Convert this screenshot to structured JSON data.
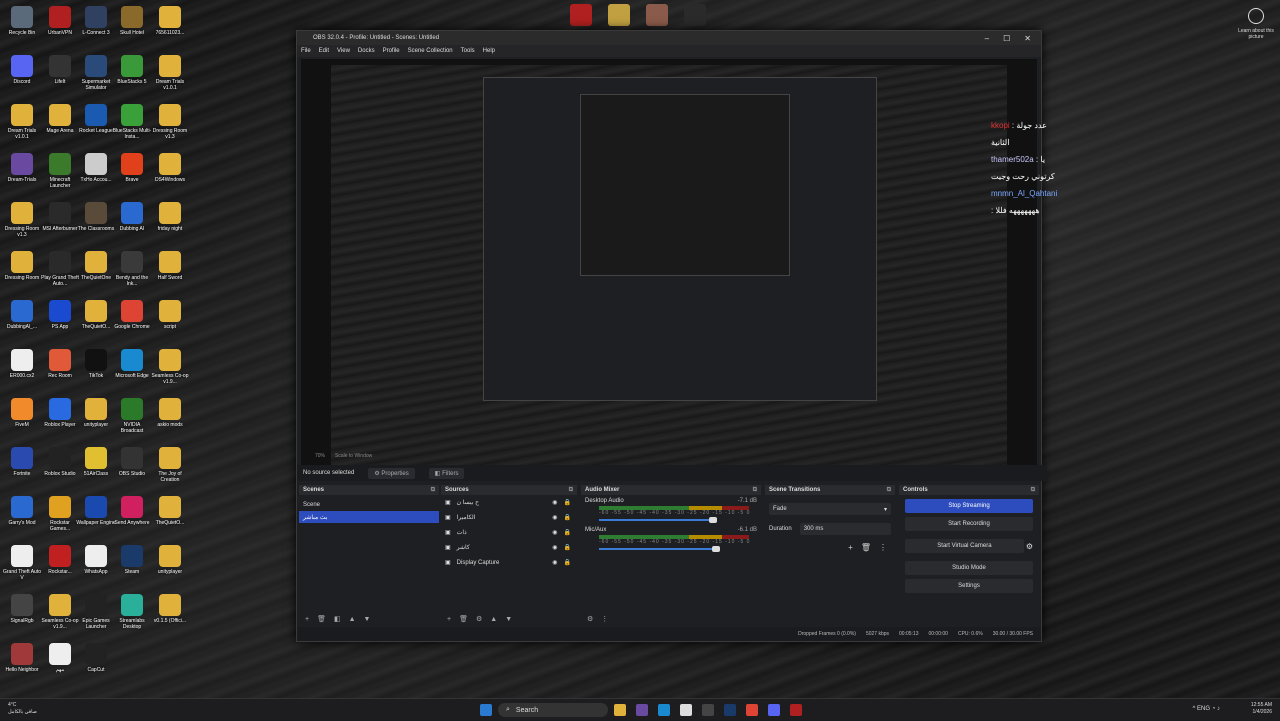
{
  "desktop": {
    "icons": [
      {
        "label": "Recycle Bin",
        "icon": "recycle-bin-icon",
        "color": "#5a6a7a"
      },
      {
        "label": "UrbanVPN",
        "icon": "urbanvpn-icon",
        "color": "#b02020"
      },
      {
        "label": "L-Connect 3",
        "icon": "l-connect-icon",
        "color": "#304060"
      },
      {
        "label": "Skull Hotel",
        "icon": "skull-icon",
        "color": "#8a6a2a"
      },
      {
        "label": "765611023...",
        "icon": "folder-icon",
        "color": "#e0b23c"
      },
      {
        "label": "Discord",
        "icon": "discord-icon",
        "color": "#5865f2"
      },
      {
        "label": "LifeIt",
        "icon": "lifeit-icon",
        "color": "#333333"
      },
      {
        "label": "Supermarket Simulator",
        "icon": "game-icon",
        "color": "#2a4a7a"
      },
      {
        "label": "BlueStacks 5",
        "icon": "bluestacks-icon",
        "color": "#3a9a3a"
      },
      {
        "label": "Dream Trials v1.0.1",
        "icon": "folder-icon",
        "color": "#e0b23c"
      },
      {
        "label": "Dream Trials v1.0.1",
        "icon": "folder-icon",
        "color": "#e0b23c"
      },
      {
        "label": "Mage Arena",
        "icon": "folder-icon",
        "color": "#e0b23c"
      },
      {
        "label": "Rocket League",
        "icon": "rocket-league-icon",
        "color": "#1a5ab0"
      },
      {
        "label": "BlueStacks Multi-Insta...",
        "icon": "bluestacks-icon",
        "color": "#3aa03a"
      },
      {
        "label": "Dressing Room v1.3",
        "icon": "folder-icon",
        "color": "#e0b23c"
      },
      {
        "label": "Dream-Trials",
        "icon": "app-icon",
        "color": "#6a4aa0"
      },
      {
        "label": "Minecraft Launcher",
        "icon": "minecraft-icon",
        "color": "#3a7a2a"
      },
      {
        "label": "TxHo Accou...",
        "icon": "app-icon",
        "color": "#cccccc"
      },
      {
        "label": "Brave",
        "icon": "brave-icon",
        "color": "#e0401a"
      },
      {
        "label": "DS4Windows",
        "icon": "folder-icon",
        "color": "#e0b23c"
      },
      {
        "label": "Dressing Room v1.3",
        "icon": "folder-icon",
        "color": "#e0b23c"
      },
      {
        "label": "MSI Afterburner",
        "icon": "msi-icon",
        "color": "#2a2a2a"
      },
      {
        "label": "The Classrooms",
        "icon": "app-icon",
        "color": "#5a4a3a"
      },
      {
        "label": "Dubbing AI",
        "icon": "dubbing-ai-icon",
        "color": "#2a6ad0"
      },
      {
        "label": "friday night",
        "icon": "folder-icon",
        "color": "#e0b23c"
      },
      {
        "label": "Dressing Room",
        "icon": "folder-icon",
        "color": "#e0b23c"
      },
      {
        "label": "Play Grand Theft Auto...",
        "icon": "gta-icon",
        "color": "#2a2a2a"
      },
      {
        "label": "TheQuietOne",
        "icon": "folder-icon",
        "color": "#e0b23c"
      },
      {
        "label": "Bendy and the Ink...",
        "icon": "game-icon",
        "color": "#3a3a3a"
      },
      {
        "label": "Half Sword",
        "icon": "folder-icon",
        "color": "#e0b23c"
      },
      {
        "label": "DubbingAl_...",
        "icon": "dubbing-ai-icon",
        "color": "#2a6ad0"
      },
      {
        "label": "PS App",
        "icon": "ps-app-icon",
        "color": "#1a4ad0"
      },
      {
        "label": "TheQuietO...",
        "icon": "folder-icon",
        "color": "#e0b23c"
      },
      {
        "label": "Google Chrome",
        "icon": "chrome-icon",
        "color": "#dd4433"
      },
      {
        "label": "script",
        "icon": "folder-icon",
        "color": "#e0b23c"
      },
      {
        "label": "ER000.cx2",
        "icon": "file-icon",
        "color": "#eeeeee"
      },
      {
        "label": "Rec Room",
        "icon": "rec-room-icon",
        "color": "#e05a3a"
      },
      {
        "label": "TikTok",
        "icon": "tiktok-icon",
        "color": "#111111"
      },
      {
        "label": "Microsoft Edge",
        "icon": "edge-icon",
        "color": "#1a8ad0"
      },
      {
        "label": "Seamless Co-op v1.9...",
        "icon": "folder-icon",
        "color": "#e0b23c"
      },
      {
        "label": "FiveM",
        "icon": "fivem-icon",
        "color": "#f08a2a"
      },
      {
        "label": "Roblox Player",
        "icon": "roblox-icon",
        "color": "#2a6ae0"
      },
      {
        "label": "unityplayer",
        "icon": "folder-icon",
        "color": "#e0b23c"
      },
      {
        "label": "NVIDIA Broadcast",
        "icon": "nvidia-icon",
        "color": "#2a7a2a"
      },
      {
        "label": "askio mods",
        "icon": "folder-icon",
        "color": "#e0b23c"
      },
      {
        "label": "Fortnite",
        "icon": "fortnite-icon",
        "color": "#2a4ab0"
      },
      {
        "label": "Roblox Studio",
        "icon": "roblox-studio-icon",
        "color": "#222222"
      },
      {
        "label": "51AirClass",
        "icon": "app-icon",
        "color": "#e0c030"
      },
      {
        "label": "OBS Studio",
        "icon": "obs-icon",
        "color": "#333333"
      },
      {
        "label": "The Joy of Creation",
        "icon": "folder-icon",
        "color": "#e0b23c"
      },
      {
        "label": "Garry's Mod",
        "icon": "gmod-icon",
        "color": "#2a6ad0"
      },
      {
        "label": "Rockstar Games...",
        "icon": "rockstar-icon",
        "color": "#e0a020"
      },
      {
        "label": "Wallpaper Engine",
        "icon": "wallpaper-engine-icon",
        "color": "#1a4ab0"
      },
      {
        "label": "Send Anywhere",
        "icon": "send-anywhere-icon",
        "color": "#d02060"
      },
      {
        "label": "TheQuietO...",
        "icon": "folder-icon",
        "color": "#e0b23c"
      },
      {
        "label": "Grand Theft Auto V",
        "icon": "file-icon",
        "color": "#eeeeee"
      },
      {
        "label": "Rockstar...",
        "icon": "rockstar-icon",
        "color": "#c02020"
      },
      {
        "label": "WhatsApp",
        "icon": "file-icon",
        "color": "#eeeeee"
      },
      {
        "label": "Steam",
        "icon": "steam-icon",
        "color": "#1a3a6a"
      },
      {
        "label": "unityplayer",
        "icon": "folder-icon",
        "color": "#e0b23c"
      },
      {
        "label": "SignalRgb",
        "icon": "signalrgb-icon",
        "color": "#444444"
      },
      {
        "label": "Seamless Co-op v1.9...",
        "icon": "folder-icon",
        "color": "#e0b23c"
      },
      {
        "label": "Epic Games Launcher",
        "icon": "epic-icon",
        "color": "#222222"
      },
      {
        "label": "Streamlabs Desktop",
        "icon": "streamlabs-icon",
        "color": "#2ab09a"
      },
      {
        "label": "v0.1.5 (Offici...",
        "icon": "folder-icon",
        "color": "#e0b23c"
      },
      {
        "label": "Hello Neighbor",
        "icon": "game-icon",
        "color": "#a03a3a"
      },
      {
        "label": "مهم",
        "icon": "file-icon",
        "color": "#eeeeee"
      },
      {
        "label": "CapCut",
        "icon": "capcut-icon",
        "color": "#222222"
      }
    ],
    "top_icons": [
      {
        "icon": "app-icon-red",
        "color": "#b02020"
      },
      {
        "icon": "app-icon-p",
        "color": "#c0a040"
      },
      {
        "icon": "avatar-icon",
        "color": "#8a5a4a"
      },
      {
        "icon": "app-icon-dark",
        "color": "#2a2a2a"
      }
    ],
    "learn_more": "Learn about this picture"
  },
  "obs": {
    "title": "OBS 32.0.4 - Profile: Untitled - Scenes: Untitled",
    "menu": [
      "File",
      "Edit",
      "View",
      "Docks",
      "Profile",
      "Scene Collection",
      "Tools",
      "Help"
    ],
    "chat": [
      {
        "user": "kkopi",
        "msg": "عدد جولة الثانية"
      },
      {
        "user": "thamer502a",
        "msg": "يا كرتوني رحت وجيت"
      },
      {
        "user": "mnmn_Al_Qahtani",
        "msg": "هههههههه فللا"
      }
    ],
    "preview_bar": {
      "zoom": "70%",
      "scale": "Scale to Window"
    },
    "source_bar": {
      "selected": "No source selected",
      "properties": "Properties",
      "filters": "Filters"
    },
    "scenes": {
      "header": "Scenes",
      "items": [
        "Scene",
        "بث مباشر"
      ]
    },
    "sources": {
      "header": "Sources",
      "items": [
        "ح بيسا ن",
        "الكاميرا",
        "ذات",
        "كاشر",
        "Display Capture"
      ]
    },
    "mixer": {
      "header": "Audio Mixer",
      "channels": [
        {
          "name": "Desktop Audio",
          "db": "-7.1 dB",
          "level": 0.76
        },
        {
          "name": "Mic/Aux",
          "db": "-6.1 dB",
          "level": 0.78
        }
      ],
      "ticks": "-60 -55 -50 -45 -40 -35 -30 -25 -20 -15 -10 -5 0"
    },
    "transitions": {
      "header": "Scene Transitions",
      "type": "Fade",
      "duration_label": "Duration",
      "duration": "300 ms"
    },
    "controls": {
      "header": "Controls",
      "buttons": [
        "Stop Streaming",
        "Start Recording",
        "Start Virtual Camera",
        "Studio Mode",
        "Settings"
      ]
    },
    "status": {
      "dropped": "Dropped Frames 0 (0.0%)",
      "kbps": "5027 kbps",
      "live": "00:05:13",
      "rec": "00:00:00",
      "cpu": "CPU: 0.6%",
      "fps": "30.00 / 30.00 FPS"
    }
  },
  "taskbar": {
    "weather_temp": "4°C",
    "weather_desc": "صافي بالكامل",
    "search": "Search",
    "lang": "ENG",
    "time": "12:55 AM",
    "date": "1/4/2026"
  }
}
